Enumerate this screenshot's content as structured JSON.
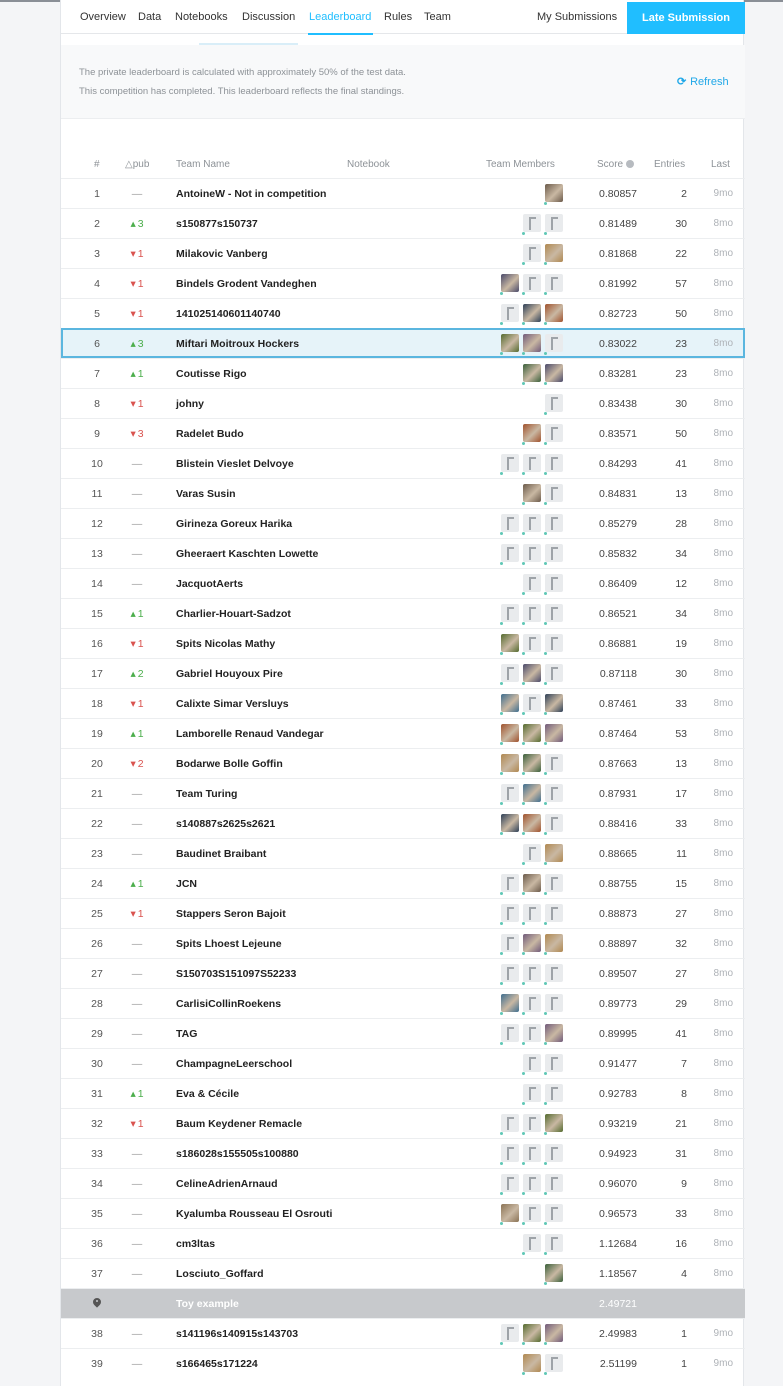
{
  "nav": {
    "tabs": [
      {
        "label": "Overview",
        "active": false
      },
      {
        "label": "Data",
        "active": false
      },
      {
        "label": "Notebooks",
        "active": false
      },
      {
        "label": "Discussion",
        "active": false
      },
      {
        "label": "Leaderboard",
        "active": true
      },
      {
        "label": "Rules",
        "active": false
      },
      {
        "label": "Team",
        "active": false
      }
    ],
    "my_submissions": "My Submissions",
    "late_submission": "Late Submission"
  },
  "info": {
    "line1": "The private leaderboard is calculated with approximately 50% of the test data.",
    "line2": "This competition has completed. This leaderboard reflects the final standings.",
    "refresh_label": "Refresh"
  },
  "table": {
    "headers": {
      "rank": "#",
      "delta": "△pub",
      "team_name": "Team Name",
      "notebook": "Notebook",
      "team_members": "Team Members",
      "score": "Score",
      "entries": "Entries",
      "last": "Last"
    },
    "colors": {
      "accent": "#20beff",
      "up": "#4cae4c",
      "down": "#d9534f",
      "benchmark_bg": "#c7c9cc"
    },
    "rows": [
      {
        "rank": "1",
        "delta": "—",
        "dir": "same",
        "team": "AntoineW - Not in competition",
        "members": [
          "photo"
        ],
        "score": "0.80857",
        "entries": "2",
        "last": "9mo"
      },
      {
        "rank": "2",
        "delta": "3",
        "dir": "up",
        "team": "s150877s150737",
        "members": [
          "default",
          "default"
        ],
        "score": "0.81489",
        "entries": "30",
        "last": "8mo"
      },
      {
        "rank": "3",
        "delta": "1",
        "dir": "down",
        "team": "Milakovic Vanberg",
        "members": [
          "default",
          "photo"
        ],
        "score": "0.81868",
        "entries": "22",
        "last": "8mo"
      },
      {
        "rank": "4",
        "delta": "1",
        "dir": "down",
        "team": "Bindels Grodent Vandeghen",
        "members": [
          "photo",
          "default",
          "default"
        ],
        "score": "0.81992",
        "entries": "57",
        "last": "8mo"
      },
      {
        "rank": "5",
        "delta": "1",
        "dir": "down",
        "team": "141025140601140740",
        "members": [
          "default",
          "photo",
          "photo"
        ],
        "score": "0.82723",
        "entries": "50",
        "last": "8mo"
      },
      {
        "rank": "6",
        "delta": "3",
        "dir": "up",
        "team": "Miftari Moitroux Hockers",
        "members": [
          "photo",
          "photo",
          "default"
        ],
        "score": "0.83022",
        "entries": "23",
        "last": "8mo",
        "selected": true
      },
      {
        "rank": "7",
        "delta": "1",
        "dir": "up",
        "team": "Coutisse Rigo",
        "members": [
          "photo",
          "photo"
        ],
        "score": "0.83281",
        "entries": "23",
        "last": "8mo"
      },
      {
        "rank": "8",
        "delta": "1",
        "dir": "down",
        "team": "johny",
        "members": [
          "default"
        ],
        "score": "0.83438",
        "entries": "30",
        "last": "8mo"
      },
      {
        "rank": "9",
        "delta": "3",
        "dir": "down",
        "team": "Radelet Budo",
        "members": [
          "photo",
          "default"
        ],
        "score": "0.83571",
        "entries": "50",
        "last": "8mo"
      },
      {
        "rank": "10",
        "delta": "—",
        "dir": "same",
        "team": "Blistein Vieslet Delvoye",
        "members": [
          "default",
          "default",
          "default"
        ],
        "score": "0.84293",
        "entries": "41",
        "last": "8mo"
      },
      {
        "rank": "11",
        "delta": "—",
        "dir": "same",
        "team": "Varas Susin",
        "members": [
          "photo",
          "default"
        ],
        "score": "0.84831",
        "entries": "13",
        "last": "8mo"
      },
      {
        "rank": "12",
        "delta": "—",
        "dir": "same",
        "team": "Girineza Goreux Harika",
        "members": [
          "default",
          "default",
          "default"
        ],
        "score": "0.85279",
        "entries": "28",
        "last": "8mo"
      },
      {
        "rank": "13",
        "delta": "—",
        "dir": "same",
        "team": "Gheeraert Kaschten Lowette",
        "members": [
          "default",
          "default",
          "default"
        ],
        "score": "0.85832",
        "entries": "34",
        "last": "8mo"
      },
      {
        "rank": "14",
        "delta": "—",
        "dir": "same",
        "team": "JacquotAerts",
        "members": [
          "default",
          "default"
        ],
        "score": "0.86409",
        "entries": "12",
        "last": "8mo"
      },
      {
        "rank": "15",
        "delta": "1",
        "dir": "up",
        "team": "Charlier-Houart-Sadzot",
        "members": [
          "default",
          "default",
          "default"
        ],
        "score": "0.86521",
        "entries": "34",
        "last": "8mo"
      },
      {
        "rank": "16",
        "delta": "1",
        "dir": "down",
        "team": "Spits Nicolas Mathy",
        "members": [
          "photo",
          "default",
          "default"
        ],
        "score": "0.86881",
        "entries": "19",
        "last": "8mo"
      },
      {
        "rank": "17",
        "delta": "2",
        "dir": "up",
        "team": "Gabriel Houyoux Pire",
        "members": [
          "default",
          "photo",
          "default"
        ],
        "score": "0.87118",
        "entries": "30",
        "last": "8mo"
      },
      {
        "rank": "18",
        "delta": "1",
        "dir": "down",
        "team": "Calixte Simar Versluys",
        "members": [
          "photo",
          "default",
          "photo"
        ],
        "score": "0.87461",
        "entries": "33",
        "last": "8mo"
      },
      {
        "rank": "19",
        "delta": "1",
        "dir": "up",
        "team": "Lamborelle Renaud Vandegar",
        "members": [
          "photo",
          "photo",
          "photo"
        ],
        "score": "0.87464",
        "entries": "53",
        "last": "8mo"
      },
      {
        "rank": "20",
        "delta": "2",
        "dir": "down",
        "team": "Bodarwe Bolle Goffin",
        "members": [
          "photo",
          "photo",
          "default"
        ],
        "score": "0.87663",
        "entries": "13",
        "last": "8mo"
      },
      {
        "rank": "21",
        "delta": "—",
        "dir": "same",
        "team": "Team Turing",
        "members": [
          "default",
          "photo",
          "default"
        ],
        "score": "0.87931",
        "entries": "17",
        "last": "8mo"
      },
      {
        "rank": "22",
        "delta": "—",
        "dir": "same",
        "team": "s140887s2625s2621",
        "members": [
          "photo",
          "photo",
          "default"
        ],
        "score": "0.88416",
        "entries": "33",
        "last": "8mo"
      },
      {
        "rank": "23",
        "delta": "—",
        "dir": "same",
        "team": "Baudinet Braibant",
        "members": [
          "default",
          "photo"
        ],
        "score": "0.88665",
        "entries": "11",
        "last": "8mo"
      },
      {
        "rank": "24",
        "delta": "1",
        "dir": "up",
        "team": "JCN",
        "members": [
          "default",
          "photo",
          "default"
        ],
        "score": "0.88755",
        "entries": "15",
        "last": "8mo"
      },
      {
        "rank": "25",
        "delta": "1",
        "dir": "down",
        "team": "Stappers Seron Bajoit",
        "members": [
          "default",
          "default",
          "default"
        ],
        "score": "0.88873",
        "entries": "27",
        "last": "8mo"
      },
      {
        "rank": "26",
        "delta": "—",
        "dir": "same",
        "team": "Spits Lhoest Lejeune",
        "members": [
          "default",
          "photo",
          "photo"
        ],
        "score": "0.88897",
        "entries": "32",
        "last": "8mo"
      },
      {
        "rank": "27",
        "delta": "—",
        "dir": "same",
        "team": "S150703S151097S52233",
        "members": [
          "default",
          "default",
          "default"
        ],
        "score": "0.89507",
        "entries": "27",
        "last": "8mo"
      },
      {
        "rank": "28",
        "delta": "—",
        "dir": "same",
        "team": "CarlisiCollinRoekens",
        "members": [
          "photo",
          "default",
          "default"
        ],
        "score": "0.89773",
        "entries": "29",
        "last": "8mo"
      },
      {
        "rank": "29",
        "delta": "—",
        "dir": "same",
        "team": "TAG",
        "members": [
          "default",
          "default",
          "photo"
        ],
        "score": "0.89995",
        "entries": "41",
        "last": "8mo"
      },
      {
        "rank": "30",
        "delta": "—",
        "dir": "same",
        "team": "ChampagneLeerschool",
        "members": [
          "default",
          "default"
        ],
        "score": "0.91477",
        "entries": "7",
        "last": "8mo"
      },
      {
        "rank": "31",
        "delta": "1",
        "dir": "up",
        "team": "Eva & Cécile",
        "members": [
          "default",
          "default"
        ],
        "score": "0.92783",
        "entries": "8",
        "last": "8mo"
      },
      {
        "rank": "32",
        "delta": "1",
        "dir": "down",
        "team": "Baum Keydener Remacle",
        "members": [
          "default",
          "default",
          "photo"
        ],
        "score": "0.93219",
        "entries": "21",
        "last": "8mo"
      },
      {
        "rank": "33",
        "delta": "—",
        "dir": "same",
        "team": "s186028s155505s100880",
        "members": [
          "default",
          "default",
          "default"
        ],
        "score": "0.94923",
        "entries": "31",
        "last": "8mo"
      },
      {
        "rank": "34",
        "delta": "—",
        "dir": "same",
        "team": "CelineAdrienArnaud",
        "members": [
          "default",
          "default",
          "default"
        ],
        "score": "0.96070",
        "entries": "9",
        "last": "8mo"
      },
      {
        "rank": "35",
        "delta": "—",
        "dir": "same",
        "team": "Kyalumba Rousseau El Osrouti",
        "members": [
          "photo",
          "default",
          "default"
        ],
        "score": "0.96573",
        "entries": "33",
        "last": "8mo"
      },
      {
        "rank": "36",
        "delta": "—",
        "dir": "same",
        "team": "cm3ltas",
        "members": [
          "default",
          "default"
        ],
        "score": "1.12684",
        "entries": "16",
        "last": "8mo"
      },
      {
        "rank": "37",
        "delta": "—",
        "dir": "same",
        "team": "Losciuto_Goffard",
        "members": [
          "photo"
        ],
        "score": "1.18567",
        "entries": "4",
        "last": "8mo"
      },
      {
        "rank": "",
        "delta": "",
        "dir": "none",
        "team": "Toy example",
        "members": [],
        "score": "2.49721",
        "entries": "",
        "last": "",
        "benchmark": true
      },
      {
        "rank": "38",
        "delta": "—",
        "dir": "same",
        "team": "s141196s140915s143703",
        "members": [
          "default",
          "photo",
          "photo"
        ],
        "score": "2.49983",
        "entries": "1",
        "last": "9mo"
      },
      {
        "rank": "39",
        "delta": "—",
        "dir": "same",
        "team": "s166465s171224",
        "members": [
          "photo",
          "default"
        ],
        "score": "2.51199",
        "entries": "1",
        "last": "9mo"
      }
    ]
  }
}
